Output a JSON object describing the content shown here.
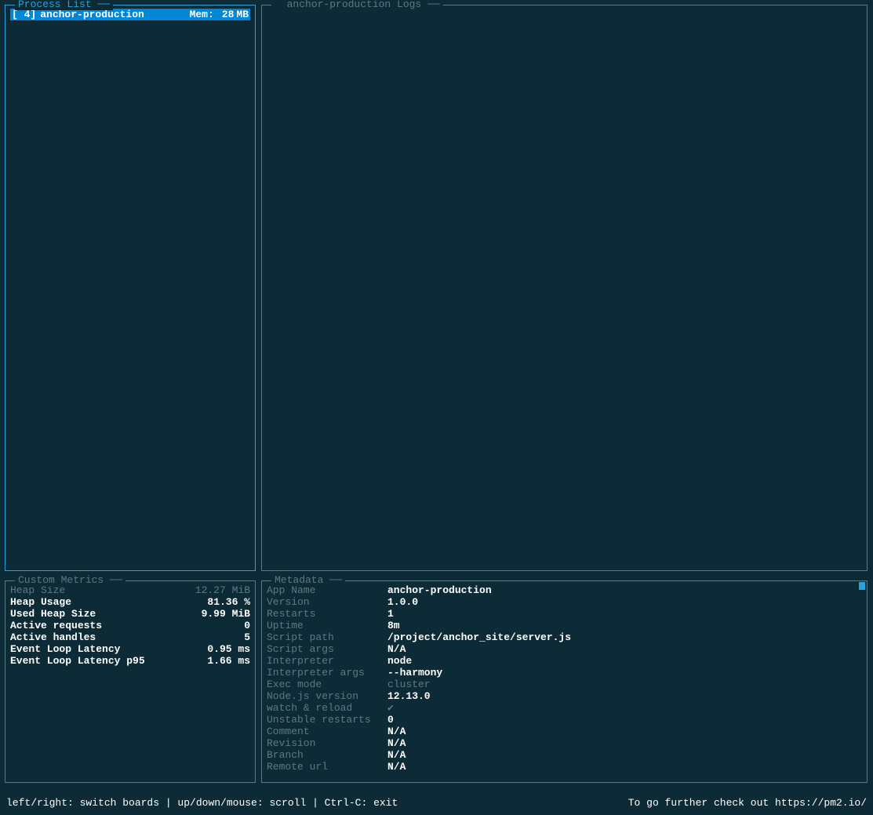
{
  "processList": {
    "title": "Process List",
    "items": [
      {
        "id": "[ 4]",
        "name": "anchor-production",
        "memLabel": "Mem:",
        "memValue": "28",
        "memUnit": "MB"
      }
    ]
  },
  "logs": {
    "title": "anchor-production Logs"
  },
  "metrics": {
    "title": "Custom Metrics",
    "rows": [
      {
        "label": "Heap Size",
        "value": "12.27 MiB",
        "dim": true
      },
      {
        "label": "Heap Usage",
        "value": "81.36 %",
        "dim": false
      },
      {
        "label": "Used Heap Size",
        "value": "9.99 MiB",
        "dim": false
      },
      {
        "label": "Active requests",
        "value": "0",
        "dim": false
      },
      {
        "label": "Active handles",
        "value": "5",
        "dim": false
      },
      {
        "label": "Event Loop Latency",
        "value": "0.95 ms",
        "dim": false
      },
      {
        "label": "Event Loop Latency p95",
        "value": "1.66 ms",
        "dim": false
      }
    ]
  },
  "metadata": {
    "title": "Metadata",
    "rows": [
      {
        "label": "App Name",
        "value": "anchor-production",
        "style": "bold"
      },
      {
        "label": "Version",
        "value": "1.0.0",
        "style": "bold"
      },
      {
        "label": "Restarts",
        "value": "1",
        "style": "bold"
      },
      {
        "label": "Uptime",
        "value": "8m",
        "style": "bold"
      },
      {
        "label": "Script path",
        "value": "/project/anchor_site/server.js",
        "style": "bold"
      },
      {
        "label": "Script args",
        "value": "N/A",
        "style": "bold"
      },
      {
        "label": "Interpreter",
        "value": "node",
        "style": "bold"
      },
      {
        "label": "Interpreter args",
        "value": "--harmony",
        "style": "bold"
      },
      {
        "label": "Exec mode",
        "value": "cluster",
        "style": "dim"
      },
      {
        "label": "Node.js version",
        "value": "12.13.0",
        "style": "bold"
      },
      {
        "label": "watch & reload",
        "value": "✔",
        "style": "check"
      },
      {
        "label": "Unstable restarts",
        "value": "0",
        "style": "bold"
      },
      {
        "label": "Comment",
        "value": "N/A",
        "style": "bold"
      },
      {
        "label": "Revision",
        "value": "N/A",
        "style": "bold"
      },
      {
        "label": "Branch",
        "value": "N/A",
        "style": "bold"
      },
      {
        "label": "Remote url",
        "value": "N/A",
        "style": "bold"
      }
    ]
  },
  "footer": {
    "left": "left/right: switch boards | up/down/mouse: scroll | Ctrl-C: exit",
    "right": "To go further check out https://pm2.io/"
  }
}
